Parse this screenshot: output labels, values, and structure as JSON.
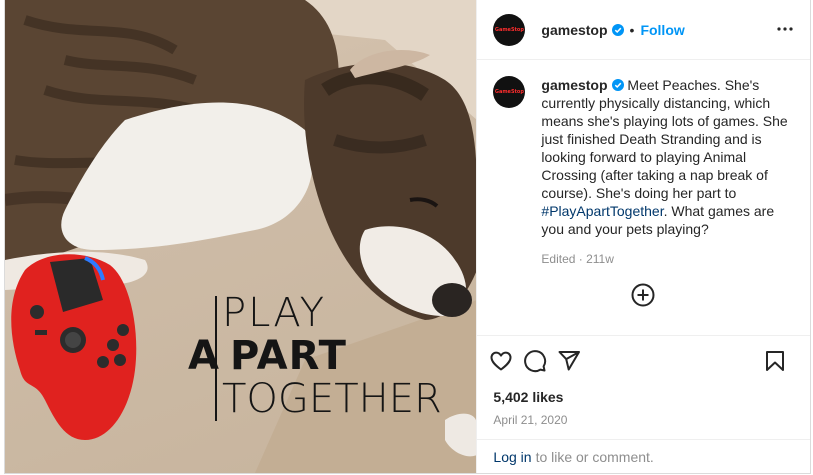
{
  "photo": {
    "caption_line1": "PLAY",
    "caption_line2_a": "A",
    "caption_line2_b": "PART",
    "caption_line3": "TOGETHER"
  },
  "header": {
    "avatar_text": "GameStop",
    "username": "gamestop",
    "separator": "•",
    "follow_label": "Follow",
    "more_icon": "more-horizontal-icon"
  },
  "caption": {
    "username": "gamestop",
    "text_before": " Meet Peaches. She's currently physically distancing, which means she's playing lots of games. She just finished Death Stranding and is looking forward to playing Animal Crossing (after taking a nap break of course). She's doing her part to ",
    "hashtag": "#PlayApartTogether",
    "text_after": ". What games are you and your pets playing?",
    "meta": "Edited · 211w"
  },
  "actions": {
    "icons": [
      "heart-icon",
      "comment-icon",
      "share-icon",
      "bookmark-icon"
    ]
  },
  "likes": "5,402 likes",
  "date": "April 21, 2020",
  "login": {
    "link": "Log in",
    "rest": "to like or comment."
  },
  "colors": {
    "accent": "#0095f6",
    "link": "#00376b",
    "controller": "#e0221f"
  }
}
